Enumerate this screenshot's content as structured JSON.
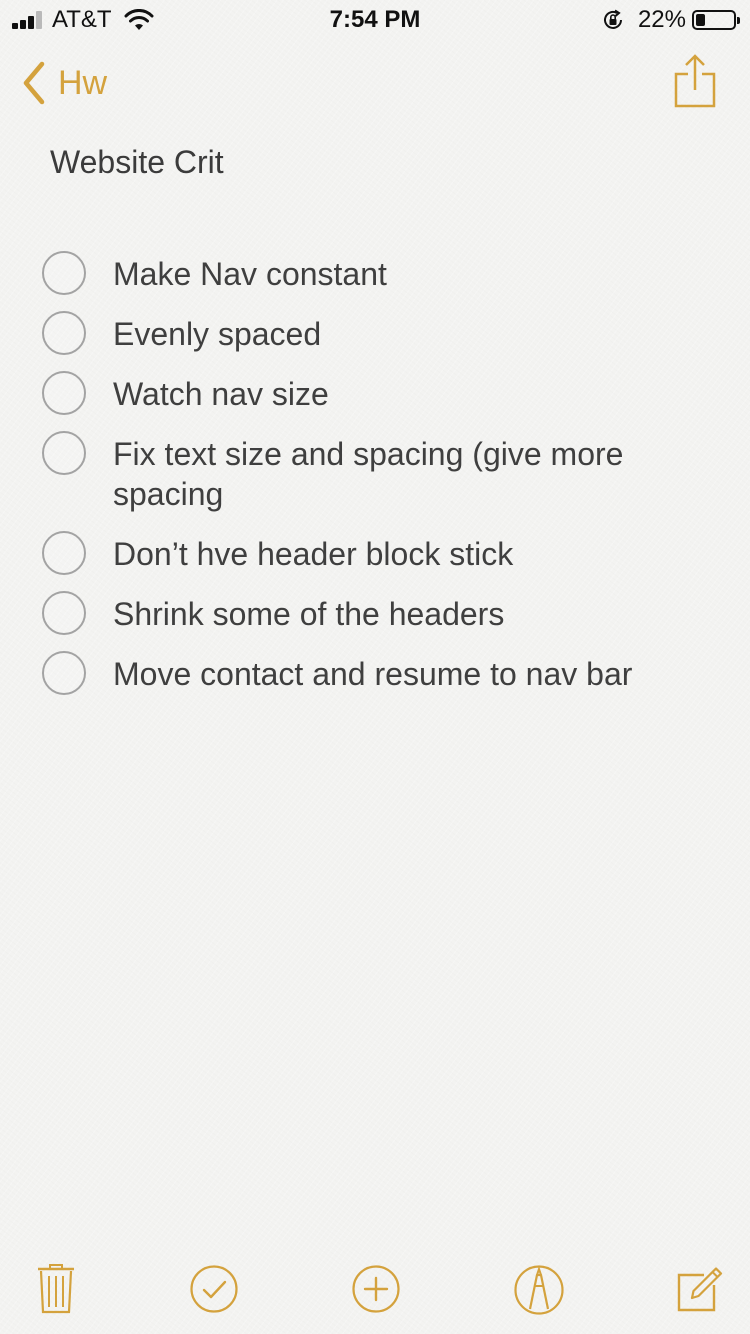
{
  "status_bar": {
    "carrier": "AT&T",
    "time": "7:54 PM",
    "battery_percent": "22%",
    "battery_level": 0.22,
    "icons": [
      "signal-icon",
      "wifi-icon",
      "rotation-lock-icon",
      "battery-icon"
    ]
  },
  "nav": {
    "back_label": "Hw",
    "icons": [
      "chevron-left-icon",
      "share-icon"
    ]
  },
  "note": {
    "title": "Website Crit",
    "items": [
      {
        "text": "Make Nav constant",
        "checked": false
      },
      {
        "text": "Evenly spaced",
        "checked": false
      },
      {
        "text": "Watch nav size",
        "checked": false
      },
      {
        "text": "Fix text size and spacing (give more spacing",
        "checked": false
      },
      {
        "text": "Don’t hve header block stick",
        "checked": false
      },
      {
        "text": "Shrink some of the headers",
        "checked": false
      },
      {
        "text": "Move contact and resume to nav bar",
        "checked": false
      }
    ]
  },
  "toolbar": {
    "icons": [
      "trash-icon",
      "checklist-icon",
      "add-icon",
      "markup-icon",
      "compose-icon"
    ]
  },
  "colors": {
    "accent": "#d4a23d",
    "background": "#f3f3f1",
    "text": "#3a3a3a",
    "checkbox_border": "#a3a3a3"
  }
}
